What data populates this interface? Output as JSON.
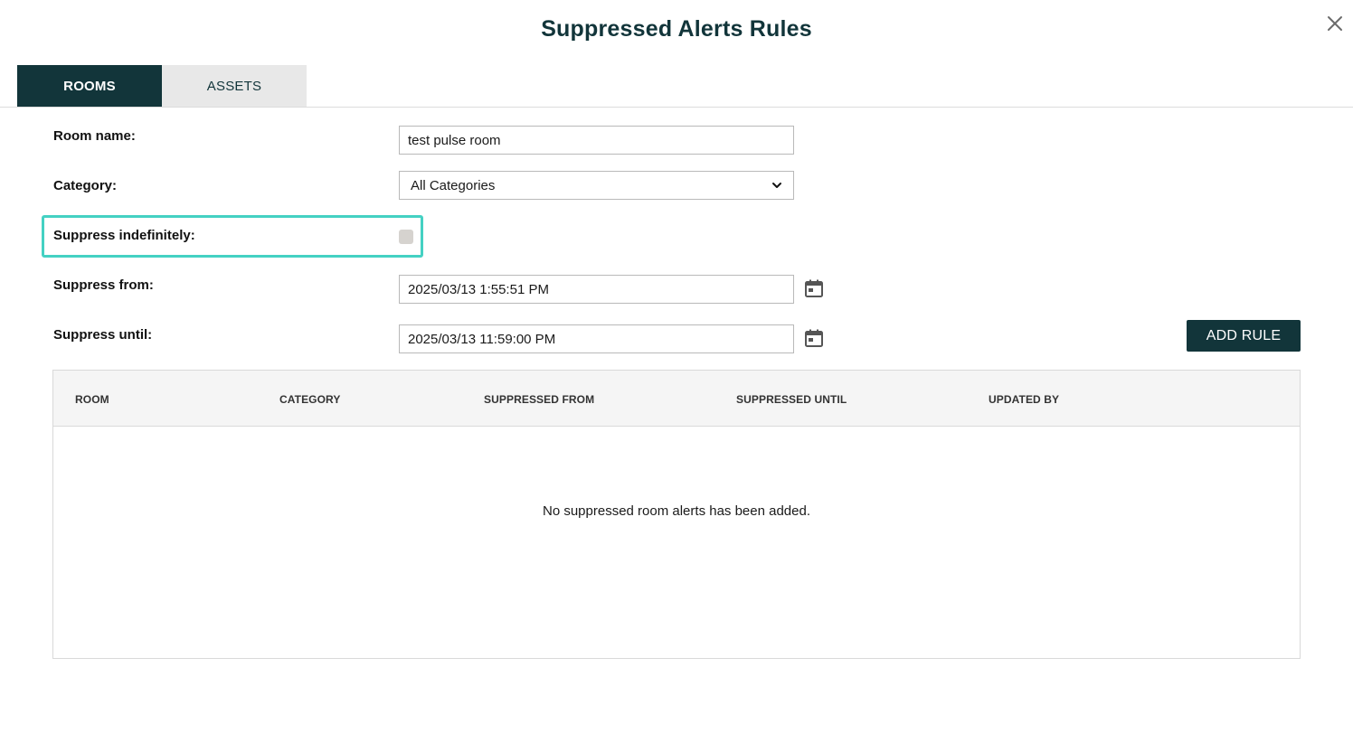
{
  "dialog": {
    "title": "Suppressed Alerts Rules"
  },
  "tabs": [
    {
      "label": "ROOMS",
      "active": true
    },
    {
      "label": "ASSETS",
      "active": false
    }
  ],
  "form": {
    "room_name": {
      "label": "Room name:",
      "value": "test pulse room"
    },
    "category": {
      "label": "Category:",
      "selected": "All Categories"
    },
    "suppress_indefinitely": {
      "label": "Suppress indefinitely:",
      "checked": false
    },
    "suppress_from": {
      "label": "Suppress from:",
      "value": "2025/03/13 1:55:51 PM"
    },
    "suppress_until": {
      "label": "Suppress until:",
      "value": "2025/03/13 11:59:00 PM"
    },
    "add_rule_label": "ADD RULE"
  },
  "grid": {
    "columns": [
      "ROOM",
      "CATEGORY",
      "SUPPRESSED FROM",
      "SUPPRESSED UNTIL",
      "UPDATED BY"
    ],
    "rows": [],
    "empty_message": "No suppressed room alerts has been added."
  },
  "icons": {
    "close": "close-icon",
    "calendar": "calendar-icon",
    "dropdown": "chevron-down-icon"
  },
  "colors": {
    "brand_dark": "#12353a",
    "focus_ring": "#44d1c3",
    "tab_inactive_bg": "#e8e8e8"
  }
}
